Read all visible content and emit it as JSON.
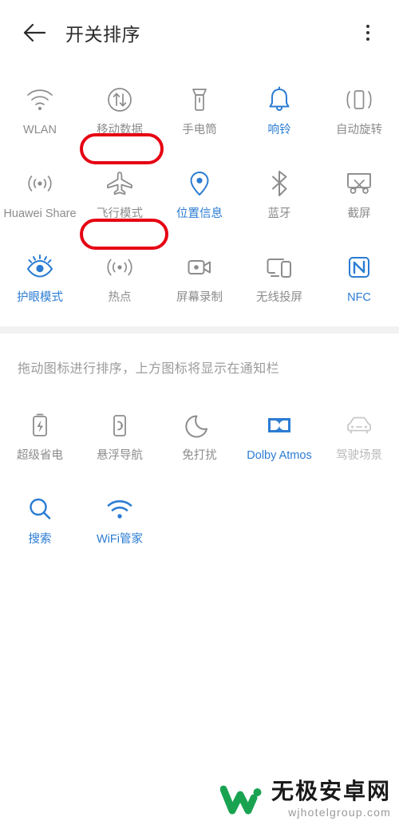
{
  "header": {
    "back_icon": "back-arrow-icon",
    "title": "开关排序",
    "menu_icon": "overflow-menu-icon"
  },
  "colors": {
    "active_blue": "#2b7cd3",
    "inactive_gray": "#8c8c8c",
    "highlight_red": "#e60012",
    "band_gray": "#f2f2f2"
  },
  "top_section": {
    "tiles": [
      {
        "label": "WLAN",
        "icon": "wifi-icon",
        "state": "inactive",
        "highlighted": false
      },
      {
        "label": "移动数据",
        "icon": "mobile-data-icon",
        "state": "inactive",
        "highlighted": true
      },
      {
        "label": "手电筒",
        "icon": "flashlight-icon",
        "state": "inactive",
        "highlighted": false
      },
      {
        "label": "响铃",
        "icon": "bell-icon",
        "state": "active",
        "highlighted": false
      },
      {
        "label": "自动旋转",
        "icon": "auto-rotate-icon",
        "state": "inactive",
        "highlighted": false
      },
      {
        "label": "Huawei Share",
        "icon": "huawei-share-icon",
        "state": "inactive",
        "highlighted": false
      },
      {
        "label": "飞行模式",
        "icon": "airplane-icon",
        "state": "inactive",
        "highlighted": true
      },
      {
        "label": "位置信息",
        "icon": "location-pin-icon",
        "state": "active",
        "highlighted": false
      },
      {
        "label": "蓝牙",
        "icon": "bluetooth-icon",
        "state": "inactive",
        "highlighted": false
      },
      {
        "label": "截屏",
        "icon": "screenshot-icon",
        "state": "inactive",
        "highlighted": false
      },
      {
        "label": "护眼模式",
        "icon": "eye-comfort-icon",
        "state": "active",
        "highlighted": false
      },
      {
        "label": "热点",
        "icon": "hotspot-icon",
        "state": "inactive",
        "highlighted": false
      },
      {
        "label": "屏幕录制",
        "icon": "screen-record-icon",
        "state": "inactive",
        "highlighted": false
      },
      {
        "label": "无线投屏",
        "icon": "cast-icon",
        "state": "inactive",
        "highlighted": false
      },
      {
        "label": "NFC",
        "icon": "nfc-icon",
        "state": "active",
        "highlighted": false
      }
    ]
  },
  "hint_text": "拖动图标进行排序，上方图标将显示在通知栏",
  "bottom_section": {
    "tiles": [
      {
        "label": "超级省电",
        "icon": "battery-saver-icon",
        "state": "inactive"
      },
      {
        "label": "悬浮导航",
        "icon": "floating-nav-icon",
        "state": "inactive"
      },
      {
        "label": "免打扰",
        "icon": "moon-icon",
        "state": "inactive"
      },
      {
        "label": "Dolby Atmos",
        "icon": "dolby-atmos-icon",
        "state": "active"
      },
      {
        "label": "驾驶场景",
        "icon": "car-icon",
        "state": "dim"
      },
      {
        "label": "搜索",
        "icon": "search-icon",
        "state": "active"
      },
      {
        "label": "WiFi管家",
        "icon": "wifi-manager-icon",
        "state": "active"
      }
    ]
  },
  "watermark": {
    "logo": "w-logo-icon",
    "site_name": "无极安卓网",
    "url": "wjhotelgroup.com"
  }
}
